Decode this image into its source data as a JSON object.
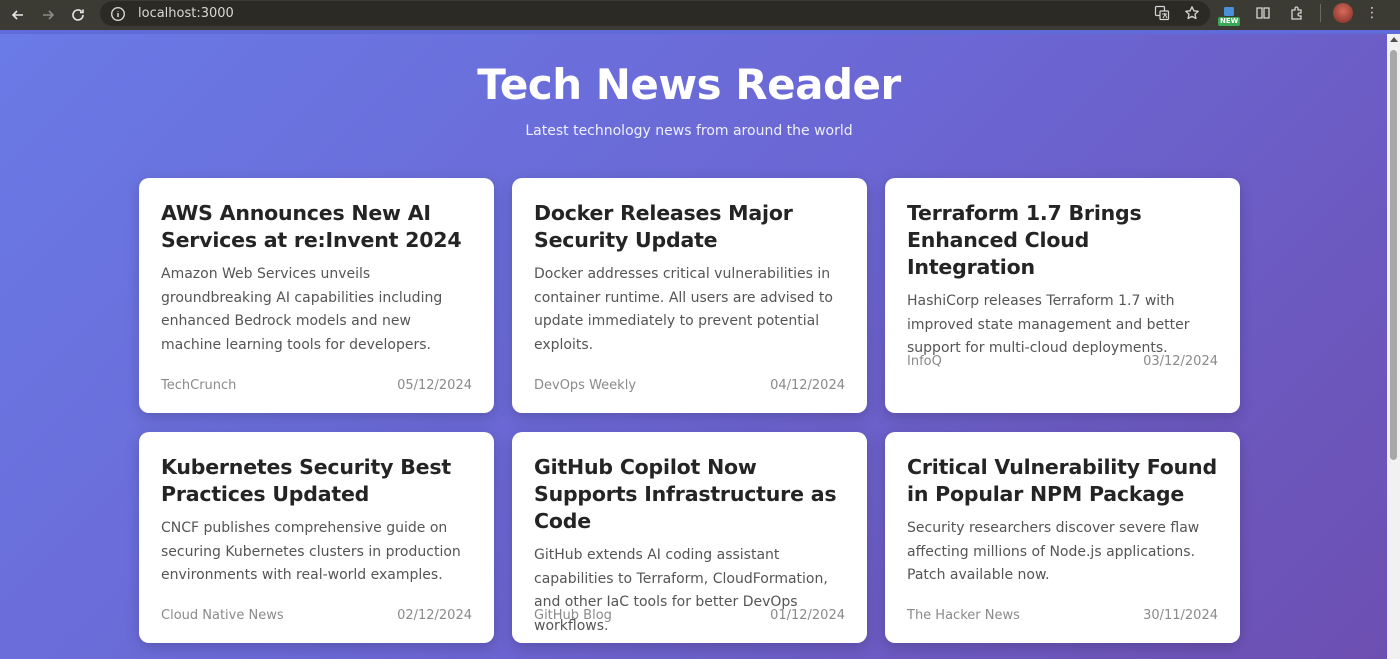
{
  "browser": {
    "url": "localhost:3000",
    "extension_badge": "NEW"
  },
  "page": {
    "title": "Tech News Reader",
    "subtitle": "Latest technology news from around the world"
  },
  "articles": [
    {
      "title": "AWS Announces New AI Services at re:Invent 2024",
      "summary": "Amazon Web Services unveils groundbreaking AI capabilities including enhanced Bedrock models and new machine learning tools for developers.",
      "source": "TechCrunch",
      "date": "05/12/2024"
    },
    {
      "title": "Docker Releases Major Security Update",
      "summary": "Docker addresses critical vulnerabilities in container runtime. All users are advised to update immediately to prevent potential exploits.",
      "source": "DevOps Weekly",
      "date": "04/12/2024"
    },
    {
      "title": "Terraform 1.7 Brings Enhanced Cloud Integration",
      "summary": "HashiCorp releases Terraform 1.7 with improved state management and better support for multi-cloud deployments.",
      "source": "InfoQ",
      "date": "03/12/2024"
    },
    {
      "title": "Kubernetes Security Best Practices Updated",
      "summary": "CNCF publishes comprehensive guide on securing Kubernetes clusters in production environments with real-world examples.",
      "source": "Cloud Native News",
      "date": "02/12/2024"
    },
    {
      "title": "GitHub Copilot Now Supports Infrastructure as Code",
      "summary": "GitHub extends AI coding assistant capabilities to Terraform, CloudFormation, and other IaC tools for better DevOps workflows.",
      "source": "GitHub Blog",
      "date": "01/12/2024"
    },
    {
      "title": "Critical Vulnerability Found in Popular NPM Package",
      "summary": "Security researchers discover severe flaw affecting millions of Node.js applications. Patch available now.",
      "source": "The Hacker News",
      "date": "30/11/2024"
    }
  ]
}
